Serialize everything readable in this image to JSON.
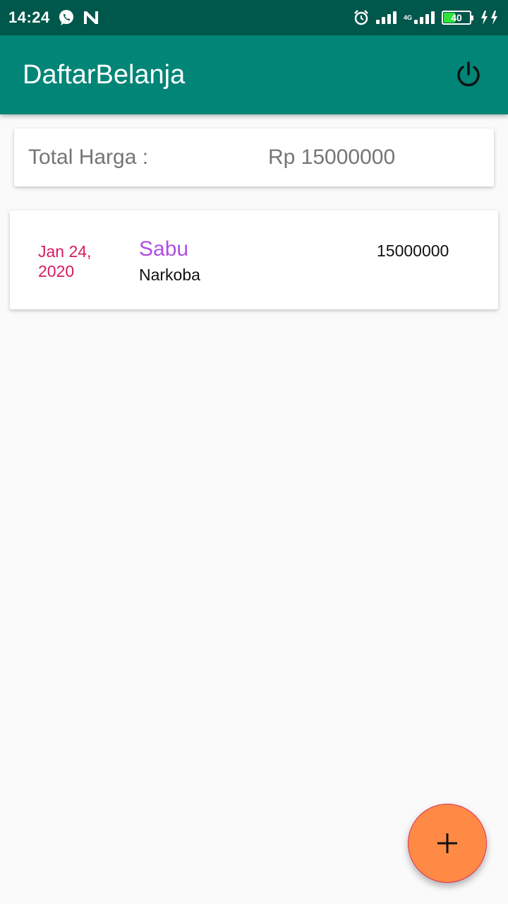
{
  "status_bar": {
    "time": "14:24",
    "network": "4G",
    "battery": "40",
    "icons": [
      "whatsapp-icon",
      "n-app-icon",
      "alarm-icon",
      "signal-icon",
      "signal-4g-icon",
      "battery-icon",
      "charging-icon"
    ]
  },
  "app_bar": {
    "title": "DaftarBelanja",
    "action_icon": "power-icon",
    "color": "#008577"
  },
  "summary": {
    "label": "Total Harga :",
    "value": "Rp 15000000"
  },
  "items": [
    {
      "date": "Jan 24, 2020",
      "name": "Sabu",
      "category": "Narkoba",
      "price": "15000000"
    }
  ],
  "fab": {
    "icon": "add-icon",
    "color": "#ff8a45"
  },
  "colors": {
    "status_bar": "#00574b",
    "app_bar": "#008577",
    "date": "#d81b60",
    "item_name": "#b14ee0",
    "fab": "#ff8a45"
  }
}
